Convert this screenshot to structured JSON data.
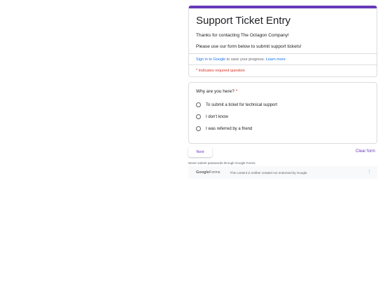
{
  "form": {
    "title": "Support Ticket Entry",
    "description_line1": "Thanks for contacting The Octagon Company!",
    "description_line2": "Please use our form below to submit support tickets!",
    "signin_link": "Sign in to Google",
    "signin_rest": " to save your progress. ",
    "learn_more": "Learn more",
    "required_note": "* Indicates required question"
  },
  "question": {
    "title": "Why are you here?",
    "required_mark": " *",
    "options": [
      "To submit a ticket for technical support",
      "I don't know",
      "I was referred by a friend"
    ]
  },
  "actions": {
    "next_label": "Next",
    "clear_label": "Clear form"
  },
  "footer": {
    "warning": "Never submit passwords through Google Forms.",
    "logo_google": "Google",
    "logo_forms": "Forms",
    "disclaimer": "This content is neither created nor endorsed by Google.",
    "menu_icon": "⋮"
  },
  "colors": {
    "accent": "#673ab7",
    "link": "#1a73e8",
    "required": "#d93025"
  }
}
